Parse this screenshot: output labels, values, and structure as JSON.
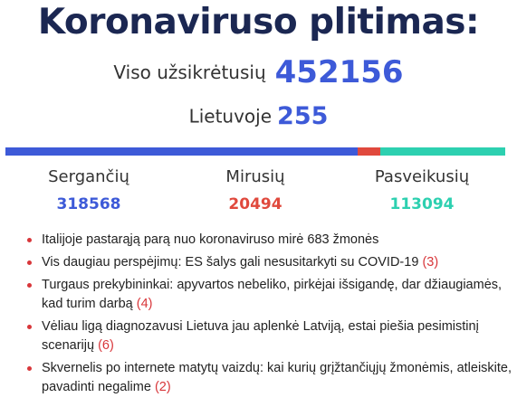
{
  "title": "Koronaviruso plitimas:",
  "total": {
    "label": "Viso užsikrėtusių",
    "value": "452156"
  },
  "lithuania": {
    "label": "Lietuvoje",
    "value": "255"
  },
  "colors": {
    "accent": "#3d5ad8",
    "sick": "#3d5ad8",
    "dead": "#e0493d",
    "recovered": "#2dd0b0",
    "title": "#1b2752",
    "link_count": "#d8363a"
  },
  "progress": {
    "sick_fraction": 0.7045,
    "dead_fraction": 0.0453,
    "recovered_fraction": 0.2501
  },
  "stats": [
    {
      "label": "Sergančių",
      "value": "318568",
      "color": "#3d5ad8"
    },
    {
      "label": "Mirusių",
      "value": "20494",
      "color": "#e0493d"
    },
    {
      "label": "Pasveikusių",
      "value": "113094",
      "color": "#2dd0b0"
    }
  ],
  "news": [
    {
      "text": "Italijoje pastarąją parą nuo koronaviruso mirė 683 žmonės",
      "count": ""
    },
    {
      "text": "Vis daugiau perspėjimų: ES šalys gali nesusitarkyti su COVID-19",
      "count": "(3)"
    },
    {
      "text": "Turgaus prekybininkai: apyvartos nebeliko, pirkėjai išsigandę, dar džiaugiamės, kad turim darbą",
      "count": "(4)"
    },
    {
      "text": "Vėliau ligą diagnozavusi Lietuva jau aplenkė Latviją, estai piešia pesimistinį scenarijų",
      "count": "(6)"
    },
    {
      "text": "Skvernelis po internete matytų vaizdų: kai kurių grįžtančiųjų žmonėmis, atleiskite, pavadinti negalime",
      "count": "(2)"
    }
  ]
}
